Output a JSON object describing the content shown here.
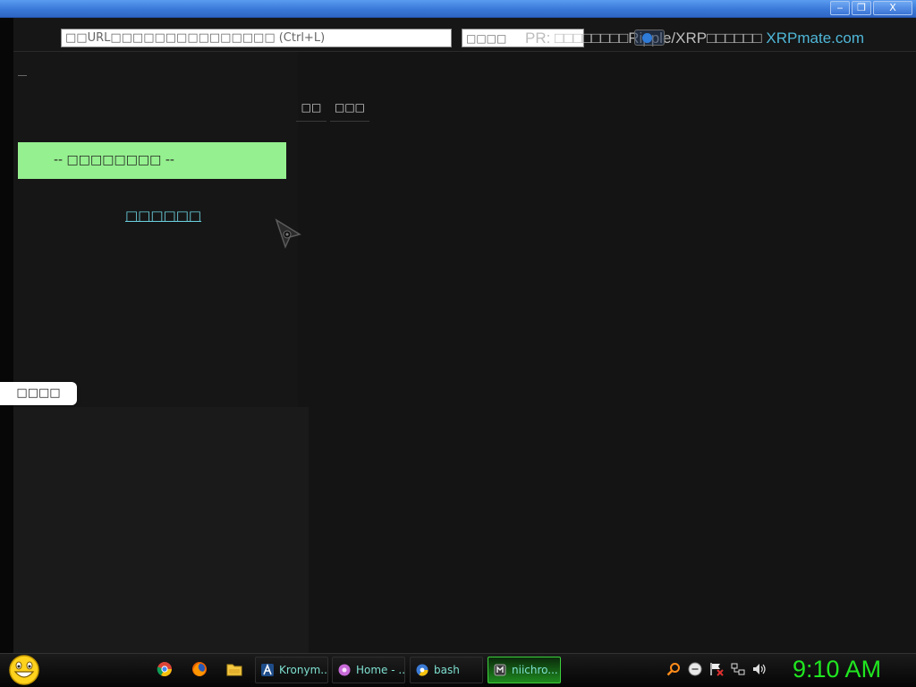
{
  "window": {
    "minimize_label": "‒",
    "restore_label": "❐",
    "close_label": "X"
  },
  "toolbar": {
    "url_placeholder": "□□URL□□□□□□□□□□□□□□□ (Ctrl+L)",
    "search_placeholder": "□□□□",
    "pr_prefix": "PR: □□□□□□□□Ripple/XRP□□□□□□ ",
    "pr_link": "XRPmate.com"
  },
  "left_panel": {
    "dropdown_label": "-- □□□□□□□□ --",
    "link_label": "□□□□□□",
    "side_tab_label": "□□□□"
  },
  "main": {
    "tabs": [
      {
        "label": "□□"
      },
      {
        "label": "□□□"
      }
    ]
  },
  "taskbar": {
    "tasks": [
      {
        "label": "Kronym...",
        "icon": "kronym-icon",
        "active": false
      },
      {
        "label": "Home - ...",
        "icon": "home-flower-icon",
        "active": false
      },
      {
        "label": "bash",
        "icon": "bash-icon",
        "active": false
      },
      {
        "label": "niichro...",
        "icon": "niichrome-icon",
        "active": true
      }
    ],
    "clock": "9:10 AM"
  },
  "colors": {
    "dropdown_bg": "#95f08f",
    "link": "#6cd2e0",
    "clock": "#20e620",
    "active_task": "#1e8a1e"
  }
}
